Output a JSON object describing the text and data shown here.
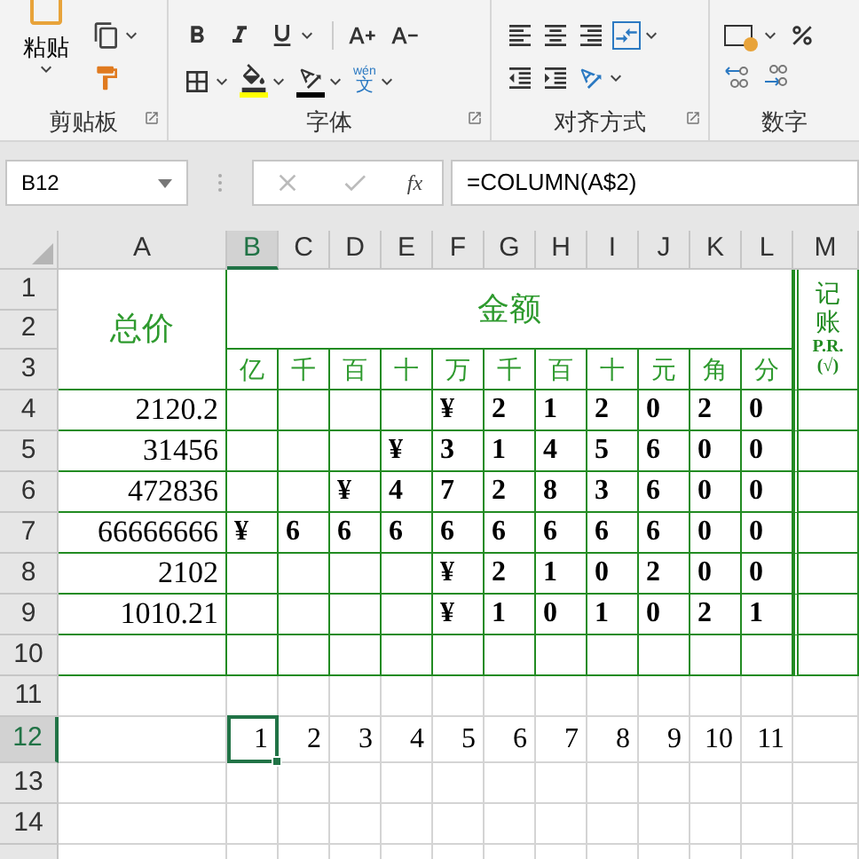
{
  "ribbon": {
    "paste_label": "粘贴",
    "phonetic_top": "wén",
    "phonetic_char": "文",
    "groups": [
      "剪贴板",
      "字体",
      "对齐方式",
      "数字"
    ]
  },
  "formula_bar": {
    "name_box": "B12",
    "fx_label": "fx",
    "formula": "=COLUMN(A$2)"
  },
  "columns": [
    {
      "label": "A",
      "selected": false
    },
    {
      "label": "B",
      "selected": true
    },
    {
      "label": "C",
      "selected": false
    },
    {
      "label": "D",
      "selected": false
    },
    {
      "label": "E",
      "selected": false
    },
    {
      "label": "F",
      "selected": false
    },
    {
      "label": "G",
      "selected": false
    },
    {
      "label": "H",
      "selected": false
    },
    {
      "label": "I",
      "selected": false
    },
    {
      "label": "J",
      "selected": false
    },
    {
      "label": "K",
      "selected": false
    },
    {
      "label": "L",
      "selected": false
    },
    {
      "label": "M",
      "selected": false
    }
  ],
  "rows": [
    {
      "label": "1",
      "selected": false
    },
    {
      "label": "2",
      "selected": false
    },
    {
      "label": "3",
      "selected": false
    },
    {
      "label": "4",
      "selected": false
    },
    {
      "label": "5",
      "selected": false
    },
    {
      "label": "6",
      "selected": false
    },
    {
      "label": "7",
      "selected": false
    },
    {
      "label": "8",
      "selected": false
    },
    {
      "label": "9",
      "selected": false
    },
    {
      "label": "10",
      "selected": false
    },
    {
      "label": "11",
      "selected": false
    },
    {
      "label": "12",
      "selected": true
    },
    {
      "label": "13",
      "selected": false
    },
    {
      "label": "14",
      "selected": false
    }
  ],
  "table": {
    "total_header": "总价",
    "amount_header": "金额",
    "post_header": [
      "记",
      "账",
      "P.R.",
      "(√)"
    ],
    "units": [
      "亿",
      "千",
      "百",
      "十",
      "万",
      "千",
      "百",
      "十",
      "元",
      "角",
      "分"
    ],
    "entries": [
      {
        "total": "2120.2",
        "digits": [
          "¥",
          "2",
          "1",
          "2",
          "0",
          "2",
          "0"
        ]
      },
      {
        "total": "31456",
        "digits": [
          "¥",
          "3",
          "1",
          "4",
          "5",
          "6",
          "0",
          "0"
        ]
      },
      {
        "total": "472836",
        "digits": [
          "¥",
          "4",
          "7",
          "2",
          "8",
          "3",
          "6",
          "0",
          "0"
        ]
      },
      {
        "total": "66666666",
        "digits": [
          "¥",
          "6",
          "6",
          "6",
          "6",
          "6",
          "6",
          "6",
          "6",
          "0",
          "0"
        ]
      },
      {
        "total": "2102",
        "digits": [
          "¥",
          "2",
          "1",
          "0",
          "2",
          "0",
          "0"
        ]
      },
      {
        "total": "1010.21",
        "digits": [
          "¥",
          "1",
          "0",
          "1",
          "0",
          "2",
          "1"
        ]
      }
    ]
  },
  "sequence": [
    {
      "value": "1",
      "selected": true
    },
    {
      "value": "2",
      "selected": false
    },
    {
      "value": "3",
      "selected": false
    },
    {
      "value": "4",
      "selected": false
    },
    {
      "value": "5",
      "selected": false
    },
    {
      "value": "6",
      "selected": false
    },
    {
      "value": "7",
      "selected": false
    },
    {
      "value": "8",
      "selected": false
    },
    {
      "value": "9",
      "selected": false
    },
    {
      "value": "10",
      "selected": false
    },
    {
      "value": "11",
      "selected": false
    }
  ]
}
